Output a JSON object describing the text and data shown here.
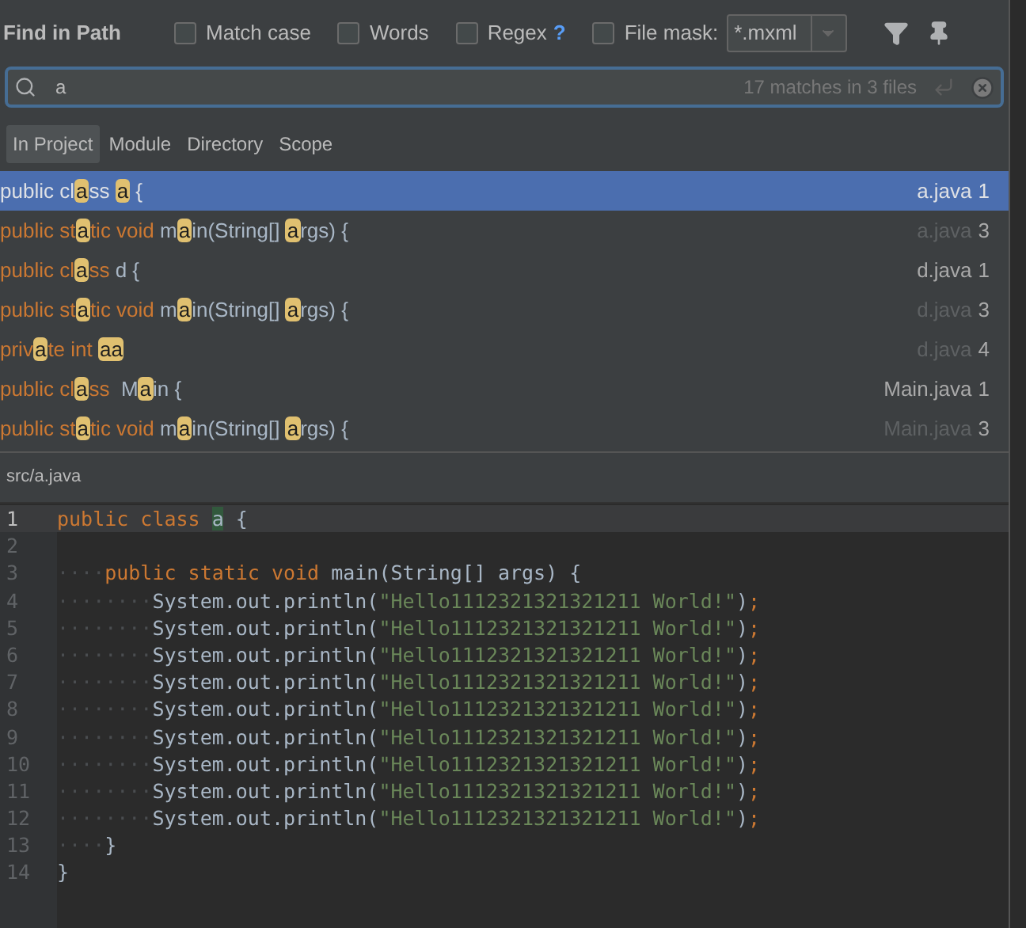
{
  "dialog": {
    "title": "Find in Path"
  },
  "options": [
    {
      "label": "Match case",
      "checked": false
    },
    {
      "label": "Words",
      "checked": false
    },
    {
      "label": "Regex",
      "checked": false,
      "help": "?"
    },
    {
      "label": "File mask:",
      "checked": false
    }
  ],
  "file_mask": {
    "value": "*.mxml"
  },
  "search": {
    "value": "a",
    "summary": "17 matches in 3 files"
  },
  "scopes": [
    {
      "label": "In Project",
      "selected": true
    },
    {
      "label": "Module",
      "selected": false
    },
    {
      "label": "Directory",
      "selected": false
    },
    {
      "label": "Scope",
      "selected": false
    }
  ],
  "results": [
    {
      "selected": true,
      "file": "a.java",
      "line": "1",
      "repeat": false,
      "segments": [
        {
          "kind": "keyword",
          "text": "public cl"
        },
        {
          "kind": "match",
          "text": "a"
        },
        {
          "kind": "keyword",
          "text": "ss "
        },
        {
          "kind": "match",
          "text": "a"
        },
        {
          "kind": "plain",
          "text": " {"
        }
      ]
    },
    {
      "selected": false,
      "file": "a.java",
      "line": "3",
      "repeat": true,
      "segments": [
        {
          "kind": "keyword",
          "text": "public st"
        },
        {
          "kind": "match",
          "text": "a"
        },
        {
          "kind": "keyword",
          "text": "tic void "
        },
        {
          "kind": "plain",
          "text": "m"
        },
        {
          "kind": "match",
          "text": "a"
        },
        {
          "kind": "plain",
          "text": "in(String[] "
        },
        {
          "kind": "match",
          "text": "a"
        },
        {
          "kind": "plain",
          "text": "rgs) {"
        }
      ]
    },
    {
      "selected": false,
      "file": "d.java",
      "line": "1",
      "repeat": false,
      "segments": [
        {
          "kind": "keyword",
          "text": "public cl"
        },
        {
          "kind": "match",
          "text": "a"
        },
        {
          "kind": "keyword",
          "text": "ss "
        },
        {
          "kind": "plain",
          "text": "d {"
        }
      ]
    },
    {
      "selected": false,
      "file": "d.java",
      "line": "3",
      "repeat": true,
      "segments": [
        {
          "kind": "keyword",
          "text": "public st"
        },
        {
          "kind": "match",
          "text": "a"
        },
        {
          "kind": "keyword",
          "text": "tic void "
        },
        {
          "kind": "plain",
          "text": "m"
        },
        {
          "kind": "match",
          "text": "a"
        },
        {
          "kind": "plain",
          "text": "in(String[] "
        },
        {
          "kind": "match",
          "text": "a"
        },
        {
          "kind": "plain",
          "text": "rgs) {"
        }
      ]
    },
    {
      "selected": false,
      "file": "d.java",
      "line": "4",
      "repeat": true,
      "segments": [
        {
          "kind": "keyword",
          "text": "priv"
        },
        {
          "kind": "match",
          "text": "a"
        },
        {
          "kind": "keyword",
          "text": "te int "
        },
        {
          "kind": "match",
          "text": "aa"
        }
      ]
    },
    {
      "selected": false,
      "file": "Main.java",
      "line": "1",
      "repeat": false,
      "segments": [
        {
          "kind": "keyword",
          "text": "public cl"
        },
        {
          "kind": "match",
          "text": "a"
        },
        {
          "kind": "keyword",
          "text": "ss "
        },
        {
          "kind": "plain",
          "text": " M"
        },
        {
          "kind": "match",
          "text": "a"
        },
        {
          "kind": "plain",
          "text": "in {"
        }
      ]
    },
    {
      "selected": false,
      "file": "Main.java",
      "line": "3",
      "repeat": true,
      "segments": [
        {
          "kind": "keyword",
          "text": "public st"
        },
        {
          "kind": "match",
          "text": "a"
        },
        {
          "kind": "keyword",
          "text": "tic void "
        },
        {
          "kind": "plain",
          "text": "m"
        },
        {
          "kind": "match",
          "text": "a"
        },
        {
          "kind": "plain",
          "text": "in(String[] "
        },
        {
          "kind": "match",
          "text": "a"
        },
        {
          "kind": "plain",
          "text": "rgs) {"
        }
      ]
    }
  ],
  "preview": {
    "path": "src/a.java",
    "lines": [
      {
        "number": "1",
        "current": true,
        "segments": [
          {
            "kind": "keyword",
            "text": "public class "
          },
          {
            "kind": "match",
            "text": "a"
          },
          {
            "kind": "plain",
            "text": " {"
          }
        ]
      },
      {
        "number": "2",
        "current": false
      },
      {
        "number": "3",
        "current": false,
        "segments": [
          {
            "kind": "space",
            "text": "····"
          },
          {
            "kind": "keyword",
            "text": "public static void "
          },
          {
            "kind": "plain",
            "text": "main(String[] args) {"
          }
        ]
      },
      {
        "number": "4",
        "current": false,
        "segments": [
          {
            "kind": "space",
            "text": "········"
          },
          {
            "kind": "plain",
            "text": "System.out.println("
          },
          {
            "kind": "string",
            "text": "\"Hello1112321321321211 World!\""
          },
          {
            "kind": "plain",
            "text": ")"
          },
          {
            "kind": "keyword",
            "text": ";"
          }
        ]
      },
      {
        "number": "5",
        "current": false,
        "segments": [
          {
            "kind": "space",
            "text": "········"
          },
          {
            "kind": "plain",
            "text": "System.out.println("
          },
          {
            "kind": "string",
            "text": "\"Hello1112321321321211 World!\""
          },
          {
            "kind": "plain",
            "text": ")"
          },
          {
            "kind": "keyword",
            "text": ";"
          }
        ]
      },
      {
        "number": "6",
        "current": false,
        "segments": [
          {
            "kind": "space",
            "text": "········"
          },
          {
            "kind": "plain",
            "text": "System.out.println("
          },
          {
            "kind": "string",
            "text": "\"Hello1112321321321211 World!\""
          },
          {
            "kind": "plain",
            "text": ")"
          },
          {
            "kind": "keyword",
            "text": ";"
          }
        ]
      },
      {
        "number": "7",
        "current": false,
        "segments": [
          {
            "kind": "space",
            "text": "········"
          },
          {
            "kind": "plain",
            "text": "System.out.println("
          },
          {
            "kind": "string",
            "text": "\"Hello1112321321321211 World!\""
          },
          {
            "kind": "plain",
            "text": ")"
          },
          {
            "kind": "keyword",
            "text": ";"
          }
        ]
      },
      {
        "number": "8",
        "current": false,
        "segments": [
          {
            "kind": "space",
            "text": "········"
          },
          {
            "kind": "plain",
            "text": "System.out.println("
          },
          {
            "kind": "string",
            "text": "\"Hello1112321321321211 World!\""
          },
          {
            "kind": "plain",
            "text": ")"
          },
          {
            "kind": "keyword",
            "text": ";"
          }
        ]
      },
      {
        "number": "9",
        "current": false,
        "segments": [
          {
            "kind": "space",
            "text": "········"
          },
          {
            "kind": "plain",
            "text": "System.out.println("
          },
          {
            "kind": "string",
            "text": "\"Hello1112321321321211 World!\""
          },
          {
            "kind": "plain",
            "text": ")"
          },
          {
            "kind": "keyword",
            "text": ";"
          }
        ]
      },
      {
        "number": "10",
        "current": false,
        "segments": [
          {
            "kind": "space",
            "text": "········"
          },
          {
            "kind": "plain",
            "text": "System.out.println("
          },
          {
            "kind": "string",
            "text": "\"Hello1112321321321211 World!\""
          },
          {
            "kind": "plain",
            "text": ")"
          },
          {
            "kind": "keyword",
            "text": ";"
          }
        ]
      },
      {
        "number": "11",
        "current": false,
        "segments": [
          {
            "kind": "space",
            "text": "········"
          },
          {
            "kind": "plain",
            "text": "System.out.println("
          },
          {
            "kind": "string",
            "text": "\"Hello1112321321321211 World!\""
          },
          {
            "kind": "plain",
            "text": ")"
          },
          {
            "kind": "keyword",
            "text": ";"
          }
        ]
      },
      {
        "number": "12",
        "current": false,
        "segments": [
          {
            "kind": "space",
            "text": "········"
          },
          {
            "kind": "plain",
            "text": "System.out.println("
          },
          {
            "kind": "string",
            "text": "\"Hello1112321321321211 World!\""
          },
          {
            "kind": "plain",
            "text": ")"
          },
          {
            "kind": "keyword",
            "text": ";"
          }
        ]
      },
      {
        "number": "13",
        "current": false,
        "segments": [
          {
            "kind": "space",
            "text": "····"
          },
          {
            "kind": "plain",
            "text": "}"
          }
        ]
      },
      {
        "number": "14",
        "current": false,
        "segments": [
          {
            "kind": "plain",
            "text": "}"
          }
        ]
      }
    ]
  }
}
